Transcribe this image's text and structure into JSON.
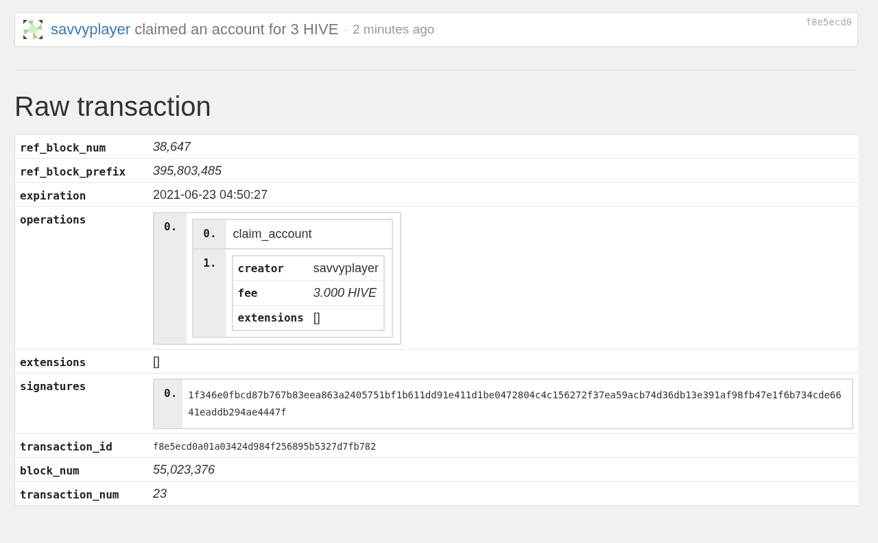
{
  "activity": {
    "user": "savvyplayer",
    "action": "claimed an account for 3 HIVE",
    "separator": "·",
    "time": "2 minutes ago",
    "tx_short": "f8e5ecd0"
  },
  "title": "Raw transaction",
  "rows": [
    {
      "key": "ref_block_num",
      "kind": "number",
      "value": "38,647"
    },
    {
      "key": "ref_block_prefix",
      "kind": "number",
      "value": "395,803,485"
    },
    {
      "key": "expiration",
      "kind": "text",
      "value": "2021-06-23 04:50:27"
    },
    {
      "key": "operations",
      "kind": "operations",
      "operations": [
        {
          "index": "0.",
          "name_index": "0.",
          "name": "claim_account",
          "params_index": "1.",
          "params": [
            {
              "key": "creator",
              "kind": "text",
              "value": "savvyplayer"
            },
            {
              "key": "fee",
              "kind": "number",
              "value": "3.000 HIVE"
            },
            {
              "key": "extensions",
              "kind": "text",
              "value": "[]"
            }
          ]
        }
      ]
    },
    {
      "key": "extensions",
      "kind": "text",
      "value": "[]"
    },
    {
      "key": "signatures",
      "kind": "array",
      "items": [
        {
          "index": "0.",
          "value": "1f346e0fbcd87b767b83eea863a2405751bf1b611dd91e411d1be0472804c4c156272f37ea59acb74d36db13e391af98fb47e1f6b734cde6641eaddb294ae4447f"
        }
      ]
    },
    {
      "key": "transaction_id",
      "kind": "hash",
      "value": "f8e5ecd0a01a03424d984f256895b5327d7fb782"
    },
    {
      "key": "block_num",
      "kind": "number",
      "value": "55,023,376"
    },
    {
      "key": "transaction_num",
      "kind": "number",
      "value": "23"
    }
  ]
}
